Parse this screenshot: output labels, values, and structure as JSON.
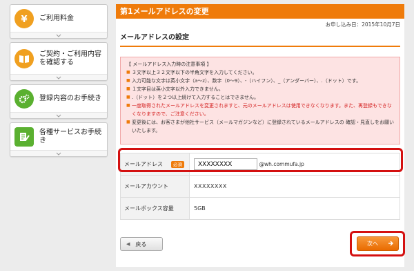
{
  "sidebar": {
    "items": [
      {
        "label": "ご利用料金",
        "icon": "yen-icon"
      },
      {
        "label": "ご契約・ご利用内容を確認する",
        "icon": "book-icon"
      },
      {
        "label": "登録内容のお手続き",
        "icon": "gear-icon"
      },
      {
        "label": "各種サービスお手続き",
        "icon": "document-pen-icon"
      }
    ]
  },
  "main": {
    "title": "第1メールアドレスの変更",
    "date": "お申し込み日：2015年10月7日",
    "section_title": "メールアドレスの設定",
    "notice": {
      "heading": "【 メールアドレス入力時の注意事項 】",
      "items": [
        {
          "text": "３文字以上３２文字以下の半角文字を入力してください。",
          "red": false
        },
        {
          "text": "入力可能な文字は英小文字（a〜z）、数字（0〜9）、-（ハイフン）、_（アンダーバー）、.（ドット）です。",
          "red": false
        },
        {
          "text": "１文字目は英小文字以外入力できません。",
          "red": false
        },
        {
          "text": ".（ドット）を２つ以上続けて入力することはできません。",
          "red": false
        },
        {
          "text": "一度取得されたメールアドレスを変更されますと、元のメールアドレスは使用できなくなります。また、再登録もできなくなりますので、ご注意ください。",
          "red": true
        },
        {
          "text": "変更後には、お客さまが他社サービス（メールマガジンなど）に登録されているメールアドレスの 確認・見直しをお願いいたします。",
          "red": false
        }
      ]
    },
    "form": {
      "email_label": "メールアドレス",
      "required_badge": "必須",
      "email_value": "XXXXXXXX",
      "email_domain": "@wh.commufa.jp",
      "account_label": "メールアカウント",
      "account_value": "XXXXXXXX",
      "mailbox_label": "メールボックス容量",
      "mailbox_value": "5GB"
    },
    "buttons": {
      "back_label": "戻る",
      "next_label": "次へ"
    }
  },
  "colors": {
    "accent": "#ef7b0a",
    "highlight": "#d41010",
    "notice_bg": "#fde3e3"
  }
}
